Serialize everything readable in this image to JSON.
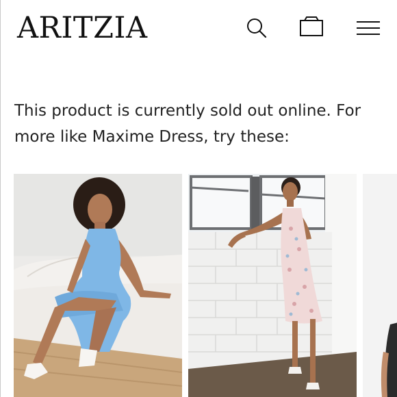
{
  "header": {
    "logo_text": "ARITZIA",
    "icons": [
      "search-icon",
      "shopping-bag-icon",
      "hamburger-menu-icon"
    ]
  },
  "message": {
    "text": "This product is currently sold out online. For more like Maxime Dress, try these:"
  },
  "products": [
    {
      "name": "product-card-blue-dress",
      "dress_color": "#7fb7e6"
    },
    {
      "name": "product-card-floral-slip-dress",
      "dress_color": "#f0d9d8"
    },
    {
      "name": "product-card-partial"
    }
  ],
  "colors": {
    "text": "#222222",
    "background": "#ffffff"
  }
}
